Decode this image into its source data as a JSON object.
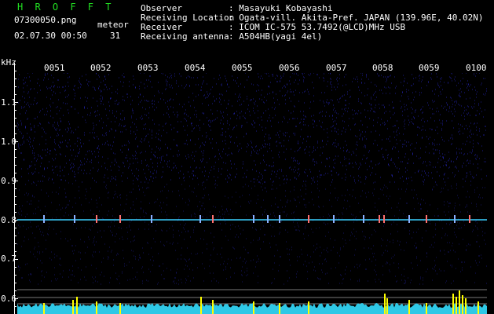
{
  "header": {
    "brand": "H R O F F T",
    "filename": "07300050.png",
    "datetime": "02.07.30 00:50",
    "meteor_label": "meteor",
    "meteor_count": "31",
    "info": [
      {
        "label": "Observer",
        "value": ": Masayuki Kobayashi"
      },
      {
        "label": "Receiving Location",
        "value": ": Ogata-vill. Akita-Pref. JAPAN (139.96E, 40.02N)"
      },
      {
        "label": "Receiver",
        "value": ": ICOM IC-575 53.7492(@LCD)MHz USB"
      },
      {
        "label": "Receiving antenna",
        "value": ": A504HB(yagi 4el)"
      }
    ]
  },
  "axis": {
    "unit": "kHz",
    "y_labels": [
      "1.1",
      "1.0",
      "0.9",
      "0.8",
      "0.7",
      "0.6"
    ],
    "x_labels": [
      "0051",
      "0052",
      "0053",
      "0054",
      "0055",
      "0056",
      "0057",
      "0058",
      "0059",
      "0100"
    ]
  },
  "colors": {
    "background": "#000000",
    "noise": "#1c1c8c",
    "carrier": "#3ad0ff",
    "histogram": "#2ec8e6",
    "meteor_bars": "#ffff00",
    "brand": "#22e022"
  }
}
